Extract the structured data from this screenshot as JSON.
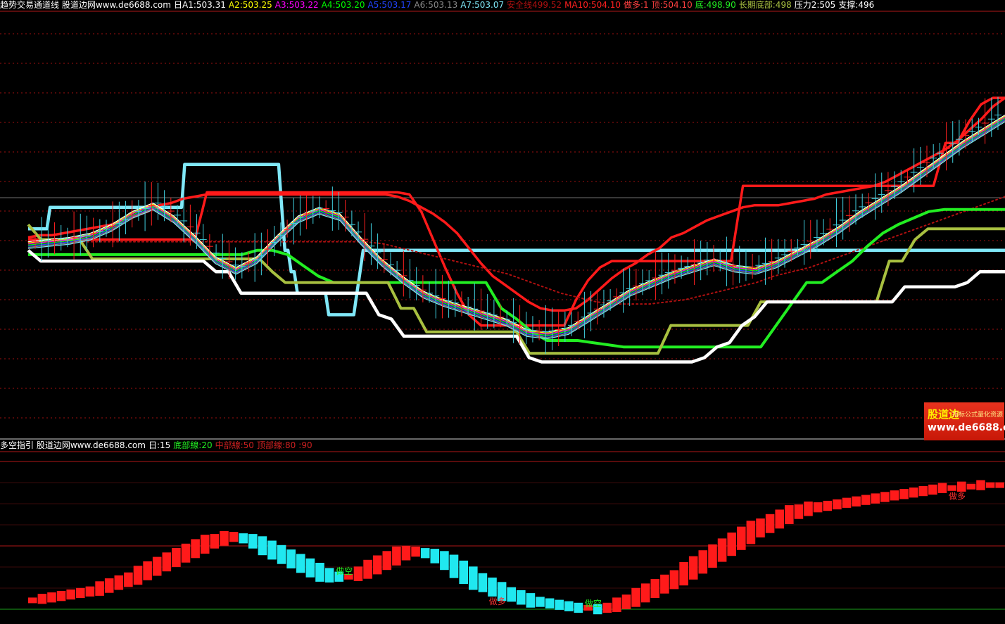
{
  "top_header": {
    "title": "趋势交易通道线 股道边网www.de6688.com",
    "period": "日",
    "items": [
      {
        "label": "A1:503.31",
        "color": "#ffffff"
      },
      {
        "label": "A2:503.25",
        "color": "#ffff00"
      },
      {
        "label": "A3:503.22",
        "color": "#ff00ff"
      },
      {
        "label": "A4:503.20",
        "color": "#00ff00"
      },
      {
        "label": "A5:503.17",
        "color": "#2244ff"
      },
      {
        "label": "A6:503.13",
        "color": "#888888"
      },
      {
        "label": "A7:503.07",
        "color": "#7fe8f8"
      },
      {
        "label": "安全线499.52",
        "color": "#b01010"
      },
      {
        "label": "MA10:504.10",
        "color": "#ff2020"
      },
      {
        "label": "做多:1",
        "color": "#ff4040"
      },
      {
        "label": "顶:504.10",
        "color": "#ff4040"
      },
      {
        "label": "底:498.90",
        "color": "#22ee22"
      },
      {
        "label": "长期底部:498",
        "color": "#a8c040"
      },
      {
        "label": "压力2:505",
        "color": "#ffffff"
      },
      {
        "label": "支撑:496",
        "color": "#ffffff"
      }
    ]
  },
  "bottom_header": {
    "title": "多空指引 股道边网www.de6688.com",
    "items": [
      {
        "label": "日:15",
        "color": "#ffffff"
      },
      {
        "label": "底部線:20",
        "color": "#22ee22"
      },
      {
        "label": "中部線:50",
        "color": "#cc2020"
      },
      {
        "label": "顶部線:80",
        "color": "#cc2020"
      },
      {
        "label": ":90",
        "color": "#cc2020"
      }
    ]
  },
  "logo": {
    "line1": "股道边",
    "line1b": "指标公式量化资源",
    "line2": "www.de6688.com"
  },
  "signals": [
    {
      "text": "做空",
      "color": "#22ee22",
      "bar": 33
    },
    {
      "text": "做多",
      "color": "#ff3030",
      "bar": 49
    },
    {
      "text": "做空",
      "color": "#22ee22",
      "bar": 59
    },
    {
      "text": "做多",
      "color": "#ff3030",
      "bar": 97
    }
  ],
  "chart_data": [
    {
      "type": "line",
      "title": "趋势交易通道线",
      "series": [
        {
          "name": "压力2",
          "color": "#80e8f8",
          "values": [
            498,
            498,
            498,
            498,
            498,
            498,
            498,
            499,
            499,
            499,
            499,
            499,
            499,
            499,
            499,
            499,
            499,
            499,
            499,
            499,
            499,
            499,
            499,
            499,
            499,
            499,
            499,
            499,
            499,
            499,
            499,
            499,
            499,
            499,
            499,
            499,
            499,
            499,
            499,
            499,
            499,
            499,
            499,
            499,
            499,
            499,
            499,
            499,
            499,
            499,
            501,
            501,
            501,
            501,
            501,
            501,
            501,
            501,
            501,
            501,
            501,
            501,
            501,
            501,
            501,
            501,
            501,
            501,
            501,
            501,
            501,
            501,
            501,
            501,
            501,
            501,
            501,
            501,
            501,
            501,
            501,
            499,
            497,
            497,
            496,
            496,
            495,
            495,
            495,
            495,
            495,
            495,
            495,
            495,
            495,
            495,
            494,
            494,
            494,
            494,
            494,
            494,
            494,
            494,
            494,
            495,
            496,
            497,
            497,
            497,
            497,
            497,
            497,
            497,
            497,
            497,
            497,
            497,
            497,
            497,
            497,
            497,
            497,
            497,
            497,
            497,
            497,
            497,
            497,
            497,
            497,
            497,
            497,
            497,
            497,
            497,
            497,
            497,
            497,
            497,
            497,
            497,
            497,
            497,
            497,
            497,
            497,
            497,
            497,
            497,
            497,
            497,
            497,
            497,
            497,
            497,
            497,
            497,
            497,
            497,
            497,
            497,
            497,
            497,
            497,
            497,
            497,
            497,
            497,
            497,
            497,
            497,
            497,
            497,
            497,
            497,
            497,
            497,
            497,
            497,
            497,
            497,
            497,
            497,
            497,
            497,
            497,
            497,
            497,
            497,
            497,
            497,
            497,
            497,
            497,
            497,
            497,
            497,
            497,
            497,
            497,
            497,
            497,
            497,
            497,
            497,
            497,
            497,
            497,
            497,
            497,
            497,
            497,
            497,
            497,
            497,
            497,
            497,
            497,
            497,
            497,
            497,
            497,
            497,
            497,
            497,
            497,
            497,
            497,
            497,
            497,
            497,
            497,
            497,
            497,
            497,
            497,
            497,
            497,
            497,
            497,
            497,
            497,
            497,
            497,
            497,
            497,
            497,
            497,
            497,
            497,
            497,
            497,
            497,
            497,
            497,
            497,
            497,
            497,
            497,
            497,
            497,
            497,
            497,
            497,
            497,
            497,
            497,
            497,
            497,
            497,
            497,
            497,
            497,
            497,
            497,
            497,
            497,
            497,
            497,
            497,
            497,
            497,
            497,
            497,
            497,
            497,
            497,
            497,
            497,
            497,
            497,
            497,
            497,
            497,
            497,
            497,
            497,
            497,
            497,
            497,
            497,
            497,
            497,
            497,
            497,
            497,
            497,
            497,
            497,
            497,
            497,
            497
          ]
        },
        {
          "name": "MA10",
          "color": "#ff1a1a",
          "values": [
            497.6,
            497.7,
            497.7,
            497.8,
            497.9,
            498,
            498.1,
            498.2,
            498.4,
            498.6,
            498.8,
            499.1,
            499.2,
            499.4,
            499.5,
            499.6,
            499.6,
            499.6,
            499.6,
            499.6,
            499.6,
            499.6,
            499.6,
            499.6,
            499.6,
            499.6,
            499.6,
            499.6,
            499.6,
            499.6,
            499.6,
            499.5,
            499.3,
            499,
            498.7,
            498.3,
            497.8,
            497.1,
            496.4,
            495.8,
            495.4,
            495,
            494.6,
            494.3,
            494.2,
            494.2,
            494.3,
            494.7,
            495.2,
            495.7,
            496.1,
            496.4,
            496.8,
            497.1,
            497.6,
            497.8,
            498.1,
            498.4,
            498.6,
            498.8,
            499,
            499.1,
            499.1,
            499.1,
            499.2,
            499.3,
            499.4,
            499.6,
            499.7,
            499.8,
            499.9,
            500,
            500.2,
            500.5,
            500.8,
            501.1,
            501.4,
            501.7,
            502.1,
            502.6,
            503.1,
            503.7,
            504.1
          ]
        },
        {
          "name": "顶",
          "color": "#ff1a1a",
          "values": [
            497.5,
            497.5,
            497.5,
            497.5,
            497.5,
            497.5,
            497.5,
            497.5,
            497.5,
            497.5,
            497.5,
            497.5,
            497.5,
            497.5,
            497.5,
            499.7,
            499.7,
            499.7,
            499.7,
            499.7,
            499.7,
            499.7,
            499.7,
            499.7,
            499.7,
            499.7,
            499.7,
            499.7,
            499.7,
            499.7,
            499.7,
            499.7,
            499.6,
            498.8,
            497.5,
            496.2,
            495,
            494,
            493.5,
            493.5,
            493.5,
            493.5,
            493.5,
            493.5,
            493.5,
            493.5,
            494.7,
            495.6,
            496.2,
            496.5,
            496.5,
            496.5,
            496.5,
            496.5,
            496.5,
            496.5,
            496.5,
            496.5,
            496.5,
            496.5,
            500,
            500,
            500,
            500,
            500,
            500,
            500,
            500,
            500,
            500,
            500,
            500,
            500,
            500,
            500,
            500,
            500,
            502,
            502,
            503,
            503.8,
            504.1,
            504.1
          ]
        },
        {
          "name": "安全线",
          "color": "#b01010",
          "values": [
            497.4,
            497.4,
            497.4,
            497.4,
            497.4,
            497.4,
            497.4,
            497.4,
            497.4,
            497.4,
            497.4,
            497.4,
            497.4,
            497.4,
            497.4,
            497.4,
            497.4,
            497.4,
            497.4,
            497.4,
            497.3,
            497.1,
            496.9,
            496.7,
            496.5,
            496.3,
            496.1,
            495.9,
            495.6,
            495.3,
            495,
            494.8,
            494.6,
            494.5,
            494.5,
            494.5,
            494.6,
            494.7,
            494.9,
            495.1,
            495.3,
            495.5,
            495.8,
            496,
            496.2,
            496.5,
            496.8,
            497.1,
            497.4,
            497.7,
            498,
            498.3,
            498.6,
            498.9,
            499.2,
            499.5
          ]
        },
        {
          "name": "底",
          "color": "#22ee22",
          "values": [
            496.8,
            496.8,
            496.8,
            496.8,
            496.8,
            496.8,
            496.8,
            496.8,
            496.8,
            496.8,
            496.8,
            496.8,
            496.8,
            496.8,
            496.8,
            497,
            497,
            496.8,
            496.3,
            495.8,
            495.5,
            495.5,
            495.5,
            495.5,
            495.5,
            495.5,
            495.5,
            495.5,
            495.5,
            495.5,
            495.5,
            494.3,
            493.8,
            493.2,
            492.8,
            492.8,
            492.8,
            492.7,
            492.6,
            492.5,
            492.5,
            492.5,
            492.5,
            492.5,
            492.5,
            492.5,
            492.5,
            492.5,
            492.5,
            493.5,
            494.5,
            495.5,
            495.5,
            496,
            496.5,
            497.2,
            497.8,
            498.2,
            498.5,
            498.8,
            498.9,
            498.9,
            498.9,
            498.9,
            498.9
          ]
        },
        {
          "name": "长期底部",
          "color": "#a8c040",
          "values": [
            498.2,
            497.5,
            497.5,
            497.5,
            497.5,
            496.6,
            496.6,
            496.6,
            496.6,
            496.6,
            496.6,
            496.6,
            496.6,
            496.6,
            496.6,
            496.6,
            496.6,
            496.6,
            496.6,
            496,
            495.5,
            495.5,
            495.5,
            495.5,
            495.5,
            495.5,
            495.5,
            495.5,
            495.5,
            494.3,
            494.3,
            493.2,
            493.2,
            493.2,
            493.2,
            493.2,
            493.2,
            493.2,
            493.2,
            492.2,
            492.2,
            492.2,
            492.2,
            492.2,
            492.2,
            492.2,
            492.2,
            492.2,
            492.2,
            492.2,
            493.5,
            493.5,
            493.5,
            493.5,
            493.5,
            493.5,
            493.5,
            494.6,
            494.6,
            494.6,
            494.6,
            494.6,
            494.6,
            494.6,
            494.6,
            494.6,
            494.6,
            496.5,
            496.5,
            497.5,
            498,
            498,
            498,
            498,
            498,
            498,
            498
          ]
        },
        {
          "name": "支撑",
          "color": "#ffffff",
          "values": [
            497,
            496.5,
            496.5,
            496.5,
            496.5,
            496.5,
            496.5,
            496.5,
            496.5,
            496.5,
            496.5,
            496.5,
            496.5,
            496.5,
            496.5,
            496,
            496,
            495,
            495,
            495,
            495,
            495,
            495,
            495,
            495,
            495,
            495,
            495,
            494,
            493.8,
            493,
            493,
            493,
            493,
            493,
            493,
            493,
            493,
            493,
            493,
            492,
            491.8,
            491.8,
            491.8,
            491.8,
            491.8,
            491.8,
            491.8,
            491.8,
            491.8,
            491.8,
            491.8,
            491.8,
            491.8,
            492,
            492.5,
            492.7,
            493.5,
            493.9,
            494.6,
            494.6,
            494.6,
            494.6,
            494.6,
            494.6,
            494.6,
            494.6,
            494.6,
            494.6,
            494.6,
            495.3,
            495.3,
            495.3,
            495.3,
            495.3,
            495.5,
            496,
            496,
            496
          ]
        },
        {
          "name": "A1",
          "color": "#ffffff",
          "values": [
            497.4,
            497.5,
            497.6,
            497.8,
            498.2,
            498.8,
            499.2,
            498.6,
            497.7,
            496.7,
            496.2,
            496.7,
            497.7,
            498.6,
            499,
            498.7,
            497.6,
            496.6,
            495.8,
            495.1,
            494.7,
            494.4,
            494.1,
            493.8,
            493.3,
            493.2,
            493.4,
            494,
            494.6,
            495.2,
            495.6,
            496,
            496.3,
            496.6,
            496.3,
            496.2,
            496.5,
            497,
            497.5,
            498.1,
            498.8,
            499.4,
            500,
            500.7,
            501.4,
            502.1,
            502.7,
            503.3
          ]
        }
      ]
    },
    {
      "type": "bar",
      "title": "多空指引",
      "series": [
        {
          "name": "多空指引",
          "values": [
            6,
            7,
            8,
            9,
            10,
            11,
            12,
            14,
            16,
            18,
            20,
            23,
            26,
            29,
            32,
            35,
            38,
            41,
            44,
            46,
            48,
            49,
            48,
            46,
            43,
            40,
            37,
            34,
            31,
            28,
            25,
            23,
            22,
            22,
            24,
            27,
            30,
            33,
            36,
            38,
            39,
            38,
            36,
            33,
            29,
            25,
            21,
            18,
            15,
            12,
            10,
            8,
            6,
            5,
            4,
            3,
            2,
            1,
            1,
            0,
            1,
            3,
            5,
            8,
            11,
            14,
            17,
            20,
            24,
            28,
            32,
            36,
            40,
            44,
            48,
            52,
            55,
            58,
            61,
            64,
            66,
            68,
            69,
            70,
            71,
            72,
            73,
            74,
            75,
            76,
            77,
            78,
            79,
            80,
            81,
            82,
            82,
            83,
            83,
            84,
            84,
            84
          ]
        }
      ],
      "ylim": [
        0,
        100
      ]
    }
  ]
}
